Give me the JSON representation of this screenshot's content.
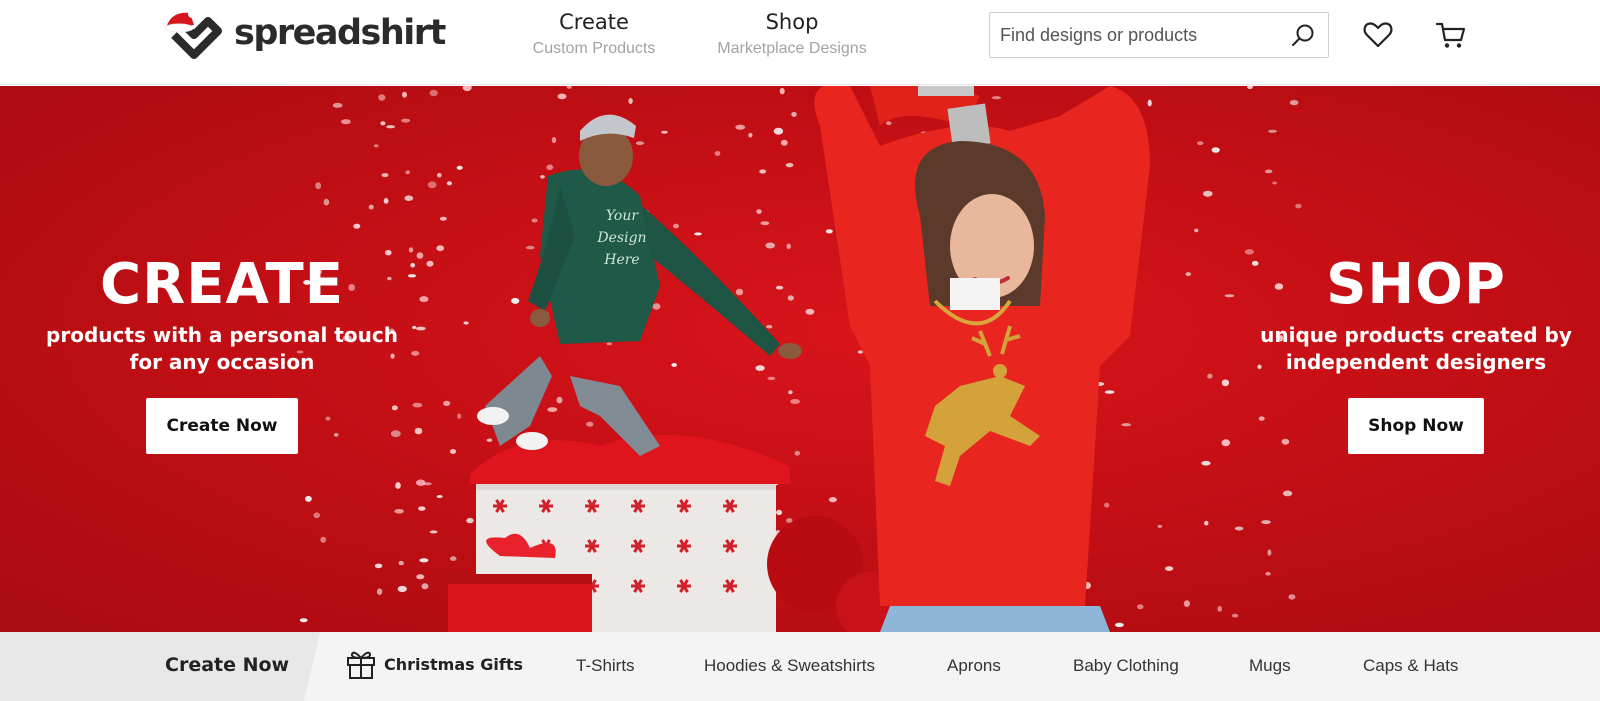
{
  "header": {
    "logo_text": "spreadshirt",
    "nav": [
      {
        "label": "Create",
        "sublabel": "Custom Products"
      },
      {
        "label": "Shop",
        "sublabel": "Marketplace Designs"
      }
    ],
    "search": {
      "placeholder": "Find designs or products",
      "value": ""
    },
    "icons": [
      "search-icon",
      "heart-icon",
      "cart-icon"
    ]
  },
  "hero": {
    "create": {
      "title": "CREATE",
      "subtitle_line1": "products with a personal touch",
      "subtitle_line2": "for any occasion",
      "button_label": "Create Now"
    },
    "shop": {
      "title": "SHOP",
      "subtitle_line1": "unique products created by",
      "subtitle_line2": "independent designers",
      "button_label": "Shop Now"
    },
    "hoodie_print": [
      "Your",
      "Design",
      "Here"
    ]
  },
  "category_bar": {
    "create_label": "Create Now",
    "items": [
      {
        "label": "Christmas Gifts",
        "icon": "gift-icon"
      },
      {
        "label": "T-Shirts"
      },
      {
        "label": "Hoodies & Sweatshirts"
      },
      {
        "label": "Aprons"
      },
      {
        "label": "Baby Clothing"
      },
      {
        "label": "Mugs"
      },
      {
        "label": "Caps & Hats"
      }
    ]
  },
  "colors": {
    "hero_red": "#c40f15",
    "sweater_red": "#e8261f",
    "hoodie_green": "#1f5a48",
    "reindeer_gold": "#d4a23a"
  }
}
